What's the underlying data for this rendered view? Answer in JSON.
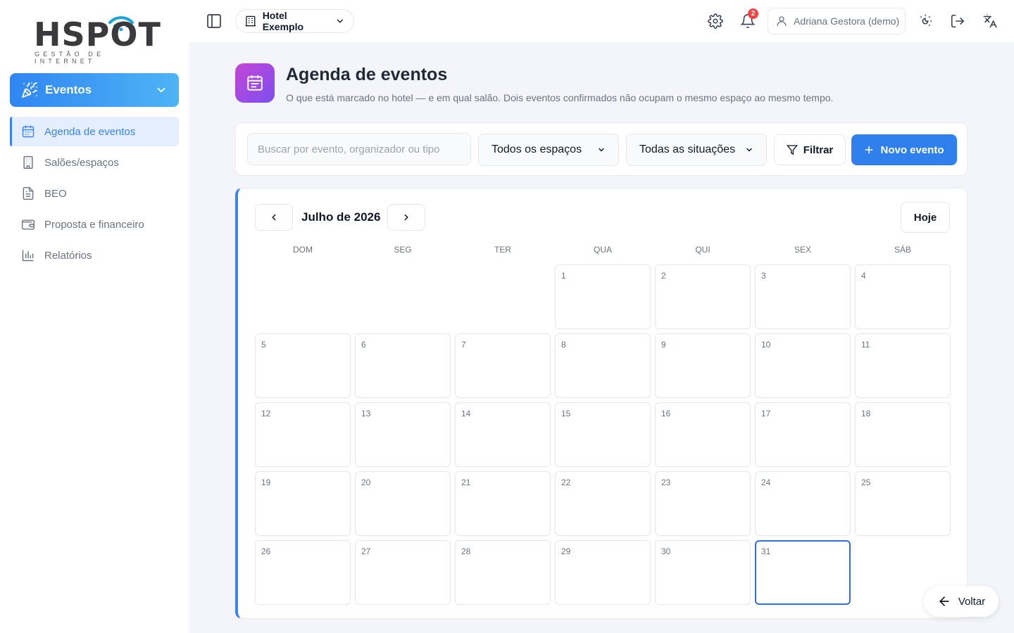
{
  "logo": {
    "text": "HSPOT",
    "subtitle": "GESTÃO DE INTERNET"
  },
  "module": {
    "label": "Eventos"
  },
  "sidebar": {
    "items": [
      {
        "label": "Agenda de eventos",
        "icon": "calendar-icon",
        "active": true
      },
      {
        "label": "Salões/espaços",
        "icon": "building-icon",
        "active": false
      },
      {
        "label": "BEO",
        "icon": "document-icon",
        "active": false
      },
      {
        "label": "Proposta e financeiro",
        "icon": "wallet-icon",
        "active": false
      },
      {
        "label": "Relatórios",
        "icon": "bar-chart-icon",
        "active": false
      }
    ]
  },
  "topbar": {
    "hotel": "Hotel Exemplo",
    "notifications_count": "2",
    "user": "Adriana Gestora (demo)"
  },
  "page": {
    "title": "Agenda de eventos",
    "subtitle": "O que está marcado no hotel — e em qual salão. Dois eventos confirmados não ocupam o mesmo espaço ao mesmo tempo."
  },
  "filters": {
    "search_placeholder": "Buscar por evento, organizador ou tipo",
    "space_select": "Todos os espaços",
    "status_select": "Todas as situações",
    "filter_label": "Filtrar",
    "new_event_label": "Novo evento"
  },
  "calendar": {
    "month_label": "Julho de 2026",
    "today_label": "Hoje",
    "weekdays": [
      "DOM",
      "SEG",
      "TER",
      "QUA",
      "QUI",
      "SEX",
      "SÁB"
    ],
    "first_weekday_index": 3,
    "days_in_month": 31,
    "highlighted_day": 31
  },
  "back": {
    "label": "Voltar"
  },
  "colors": {
    "primary": "#2f80ed",
    "active_bg": "#e3efff",
    "accent_gradient_from": "#c546d6",
    "accent_gradient_to": "#7b4ff0"
  }
}
